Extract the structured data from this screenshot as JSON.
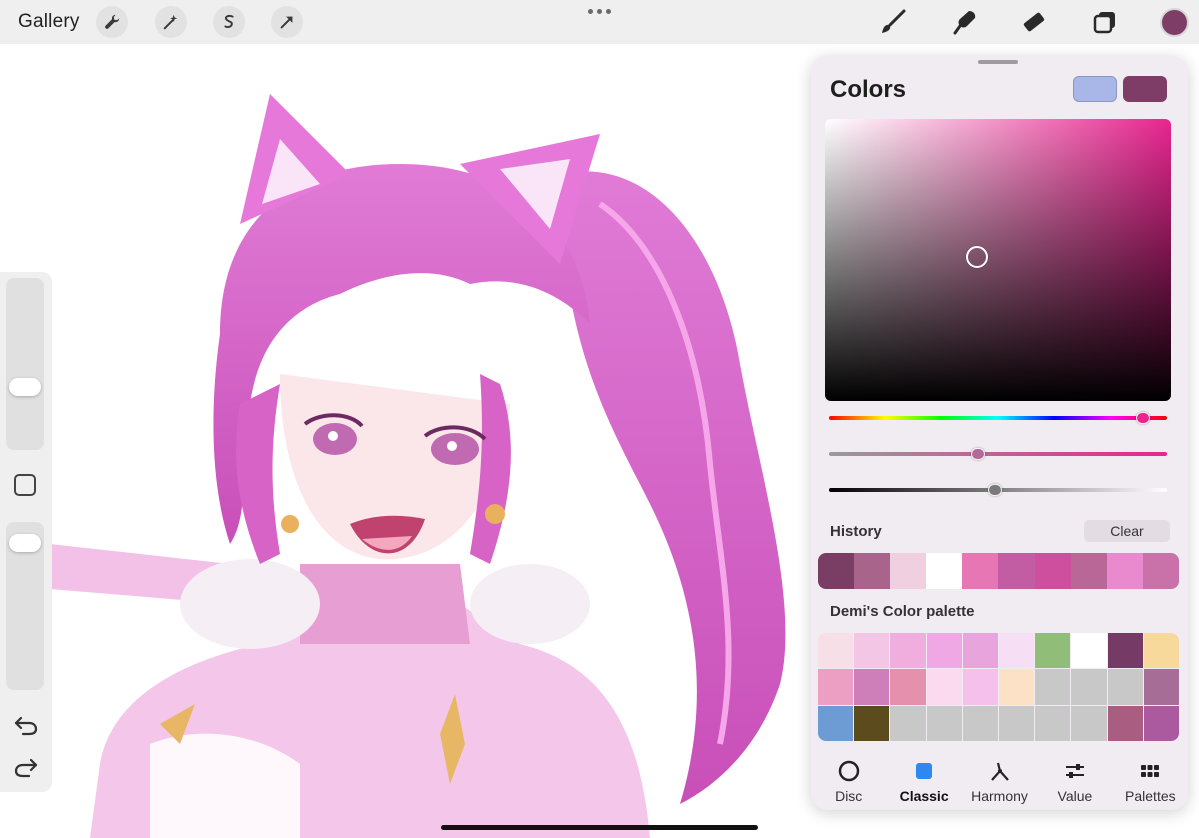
{
  "topbar": {
    "gallery_label": "Gallery",
    "left_tools": [
      {
        "name": "actions-wrench-icon"
      },
      {
        "name": "adjustments-wand-icon"
      },
      {
        "name": "selection-icon"
      },
      {
        "name": "transform-arrow-icon"
      }
    ],
    "right_tools": [
      {
        "name": "brush-icon"
      },
      {
        "name": "smudge-icon"
      },
      {
        "name": "eraser-icon"
      },
      {
        "name": "layers-icon"
      }
    ],
    "current_color": "#7e3d67"
  },
  "sidebar": {
    "brush_size_level": 0.35,
    "opacity_level": 0.92
  },
  "colors_panel": {
    "title": "Colors",
    "secondary_color": "#a9b6e8",
    "primary_color": "#7e3d67",
    "hue_color": "#e8258f",
    "picker_saturation": 0.44,
    "picker_brightness": 0.51,
    "hue_level": 0.93,
    "saturation_level": 0.44,
    "brightness_level": 0.49,
    "history_label": "History",
    "clear_label": "Clear",
    "history": [
      "#7a3d63",
      "#a8648a",
      "#efcfe0",
      "#ffffff",
      "#e777b4",
      "#c35da3",
      "#cd4f9e",
      "#b86797",
      "#e88acd",
      "#c971a9"
    ],
    "palette_label": "Demi's Color palette",
    "palette": [
      "#f7dfe8",
      "#f4c6e6",
      "#efaedd",
      "#f0a8e4",
      "#e8a5dd",
      "#f6def4",
      "#90bd78",
      "#ffffff",
      "#753a65",
      "#f7d99c",
      "#ec9fc3",
      "#ce7fb9",
      "#e590ad",
      "#fbdaf0",
      "#f5c0eb",
      "#fde1c7",
      "#c8c8c8",
      "#c8c8c8",
      "#c8c8c8",
      "#a66d97",
      "#6c9cd3",
      "#5c4b1c",
      "#c8c8c8",
      "#c8c8c8",
      "#c8c8c8",
      "#c8c8c8",
      "#c8c8c8",
      "#c8c8c8",
      "#a95d80",
      "#ab5aa0"
    ],
    "tabs": [
      {
        "label": "Disc",
        "icon": "disc-icon"
      },
      {
        "label": "Classic",
        "icon": "classic-square-icon",
        "active": true
      },
      {
        "label": "Harmony",
        "icon": "harmony-icon"
      },
      {
        "label": "Value",
        "icon": "value-sliders-icon"
      },
      {
        "label": "Palettes",
        "icon": "palettes-grid-icon"
      }
    ]
  }
}
